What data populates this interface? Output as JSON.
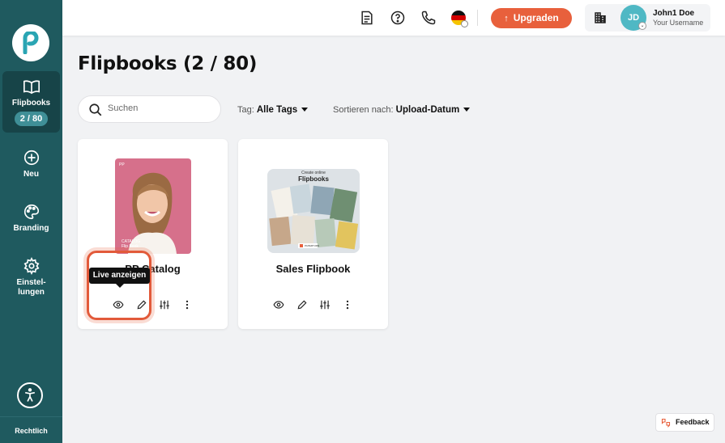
{
  "sidebar": {
    "logo": "paperturn-logo",
    "items": [
      {
        "label": "Flipbooks",
        "count": "2 / 80",
        "icon": "book-icon",
        "active": true
      },
      {
        "label": "Neu",
        "icon": "plus-circle-icon"
      },
      {
        "label": "Branding",
        "icon": "palette-icon"
      },
      {
        "label_line1": "Einstel-",
        "label_line2": "lungen",
        "icon": "gear-icon"
      }
    ],
    "accessibility_icon": "accessibility-icon",
    "legal_label": "Rechtlich"
  },
  "topbar": {
    "icons": [
      "document-icon",
      "help-icon",
      "phone-icon"
    ],
    "language": "de",
    "upgrade_label": "Upgraden",
    "account": {
      "initials": "JD",
      "name": "John1 Doe",
      "username": "Your Username"
    }
  },
  "main": {
    "title": "Flipbooks (2 / 80)",
    "search": {
      "placeholder": "Suchen",
      "value": ""
    },
    "tag_filter": {
      "label": "Tag:",
      "value": "Alle Tags"
    },
    "sort": {
      "label": "Sortieren nach:",
      "value": "Upload-Datum"
    },
    "cards": [
      {
        "title": "PP Catalog",
        "cover_texts": [
          "PP",
          "CATALOG",
          "Flip Book"
        ]
      },
      {
        "title": "Sales Flipbook",
        "cover_texts": [
          "Create online",
          "Flipbooks",
          "PAPERTURN"
        ]
      }
    ],
    "tooltip": "Live anzeigen"
  },
  "feedback_label": "Feedback",
  "colors": {
    "sidebar": "#1f5a5f",
    "accent": "#e8603c",
    "avatar": "#4fb8c4"
  }
}
